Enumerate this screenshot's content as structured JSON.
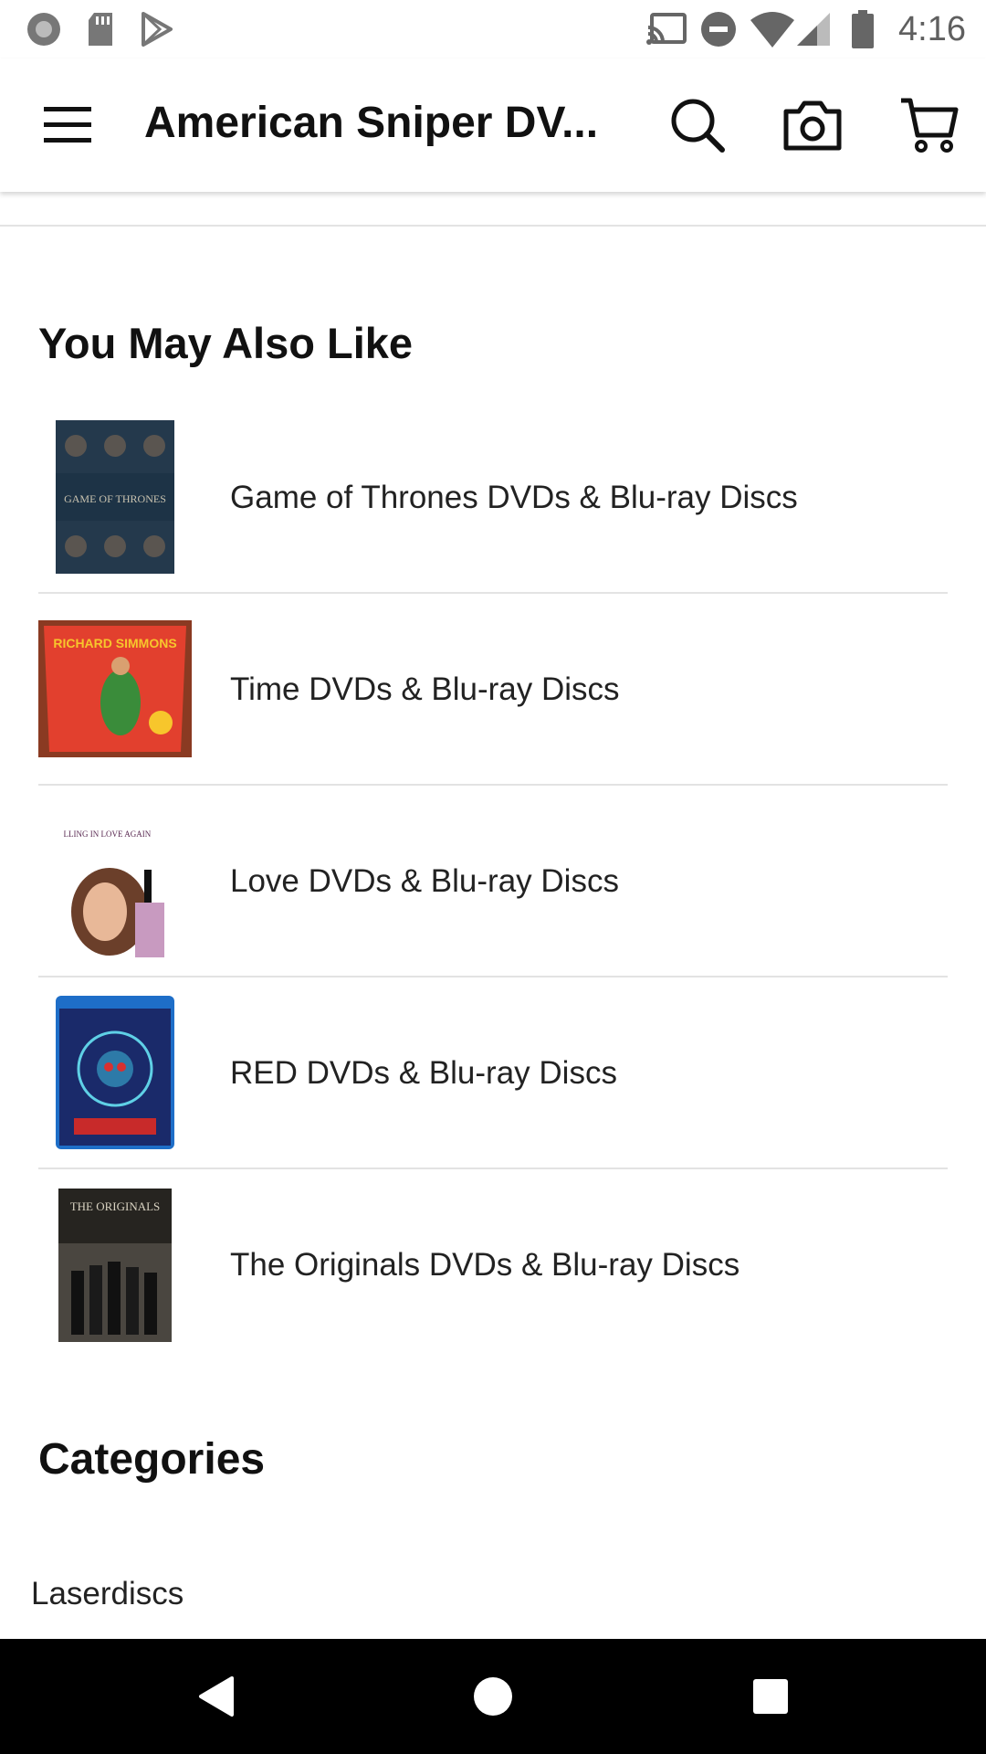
{
  "status_bar": {
    "time": "4:16",
    "left_icons": [
      "record-icon",
      "sd-card-icon",
      "play-store-icon"
    ],
    "right_icons": [
      "cast-icon",
      "do-not-disturb-icon",
      "wifi-icon",
      "signal-icon",
      "battery-icon"
    ]
  },
  "app_bar": {
    "title": "American Sniper DV...",
    "icons": [
      "menu-icon",
      "search-icon",
      "camera-icon",
      "cart-icon"
    ]
  },
  "recommendations": {
    "title": "You May Also Like",
    "items": [
      {
        "label": "Game of Thrones DVDs & Blu-ray Discs",
        "thumb_text": "GAME OF THRONES"
      },
      {
        "label": "Time DVDs & Blu-ray Discs",
        "thumb_text": "RICHARD SIMMONS"
      },
      {
        "label": "Love DVDs & Blu-ray Discs",
        "thumb_text": "FALLING IN LOVE AGAIN"
      },
      {
        "label": "RED DVDs & Blu-ray Discs",
        "thumb_text": ""
      },
      {
        "label": "The Originals DVDs & Blu-ray Discs",
        "thumb_text": "THE ORIGINALS"
      }
    ]
  },
  "categories": {
    "title": "Categories",
    "items": [
      "Laserdiscs"
    ]
  },
  "nav_bar": {
    "icons": [
      "back-icon",
      "home-icon",
      "recents-icon"
    ]
  }
}
